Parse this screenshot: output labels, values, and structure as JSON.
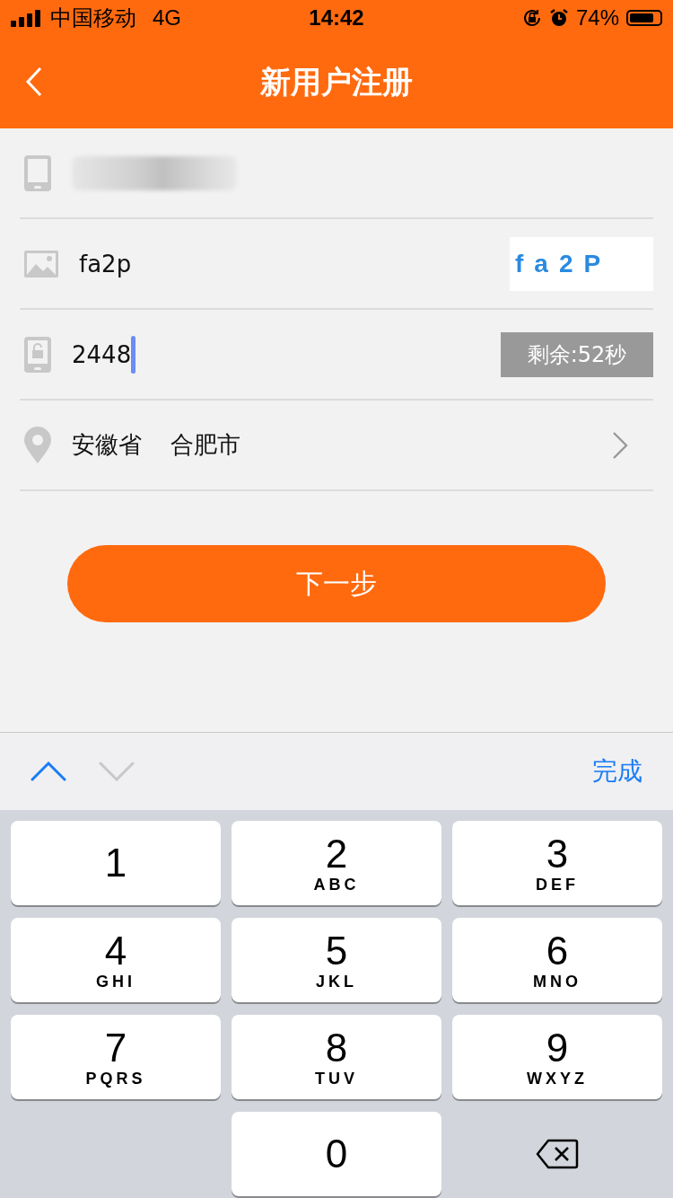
{
  "status_bar": {
    "carrier": "中国移动",
    "network": "4G",
    "time": "14:42",
    "battery": "74%"
  },
  "nav": {
    "title": "新用户注册"
  },
  "form": {
    "captcha_field": {
      "value": "fa2p",
      "captcha": "fa2P"
    },
    "sms_field": {
      "value": "2448",
      "focused": true,
      "countdown": "剩余:52秒"
    },
    "region": {
      "province": "安徽省",
      "city": "合肥市"
    },
    "next_button": "下一步"
  },
  "keyboard_toolbar": {
    "prev_enabled": true,
    "next_enabled": false,
    "done": "完成"
  },
  "keys": [
    {
      "kind": "digit",
      "digit": "1"
    },
    {
      "kind": "digit",
      "digit": "2",
      "letters": "ABC"
    },
    {
      "kind": "digit",
      "digit": "3",
      "letters": "DEF"
    },
    {
      "kind": "digit",
      "digit": "4",
      "letters": "GHI"
    },
    {
      "kind": "digit",
      "digit": "5",
      "letters": "JKL"
    },
    {
      "kind": "digit",
      "digit": "6",
      "letters": "MNO"
    },
    {
      "kind": "digit",
      "digit": "7",
      "letters": "PQRS"
    },
    {
      "kind": "digit",
      "digit": "8",
      "letters": "TUV"
    },
    {
      "kind": "digit",
      "digit": "9",
      "letters": "WXYZ"
    },
    {
      "kind": "empty"
    },
    {
      "kind": "digit",
      "digit": "0"
    },
    {
      "kind": "delete"
    }
  ]
}
